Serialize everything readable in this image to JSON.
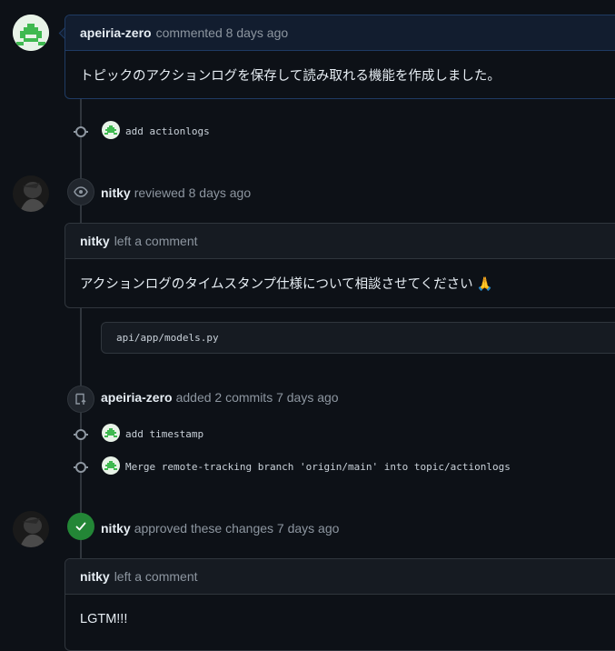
{
  "first_comment": {
    "author": "apeiria-zero",
    "action": "commented",
    "time": "8 days ago",
    "body": "トピックのアクションログを保存して読み取れる機能を作成しました。"
  },
  "commit_1": {
    "message": "add actionlogs"
  },
  "review_event": {
    "author": "nitky",
    "action": "reviewed",
    "time": "8 days ago"
  },
  "review_comment": {
    "author": "nitky",
    "action": "left a comment",
    "body": "アクションログのタイムスタンプ仕様について相談させてください 🙏"
  },
  "file_ref": {
    "path": "api/app/models.py"
  },
  "commits_event": {
    "author": "apeiria-zero",
    "action": "added 2 commits",
    "time": "7 days ago"
  },
  "commit_2": {
    "message": "add timestamp"
  },
  "commit_3": {
    "message": "Merge remote-tracking branch 'origin/main' into topic/actionlogs"
  },
  "approve_event": {
    "author": "nitky",
    "action": "approved these changes",
    "time": "7 days ago"
  },
  "approve_comment": {
    "author": "nitky",
    "action": "left a comment",
    "body": "LGTM!!!"
  },
  "colors": {
    "background": "#0d1117",
    "approve_green": "#238636",
    "owner_border": "#1f3b63"
  }
}
